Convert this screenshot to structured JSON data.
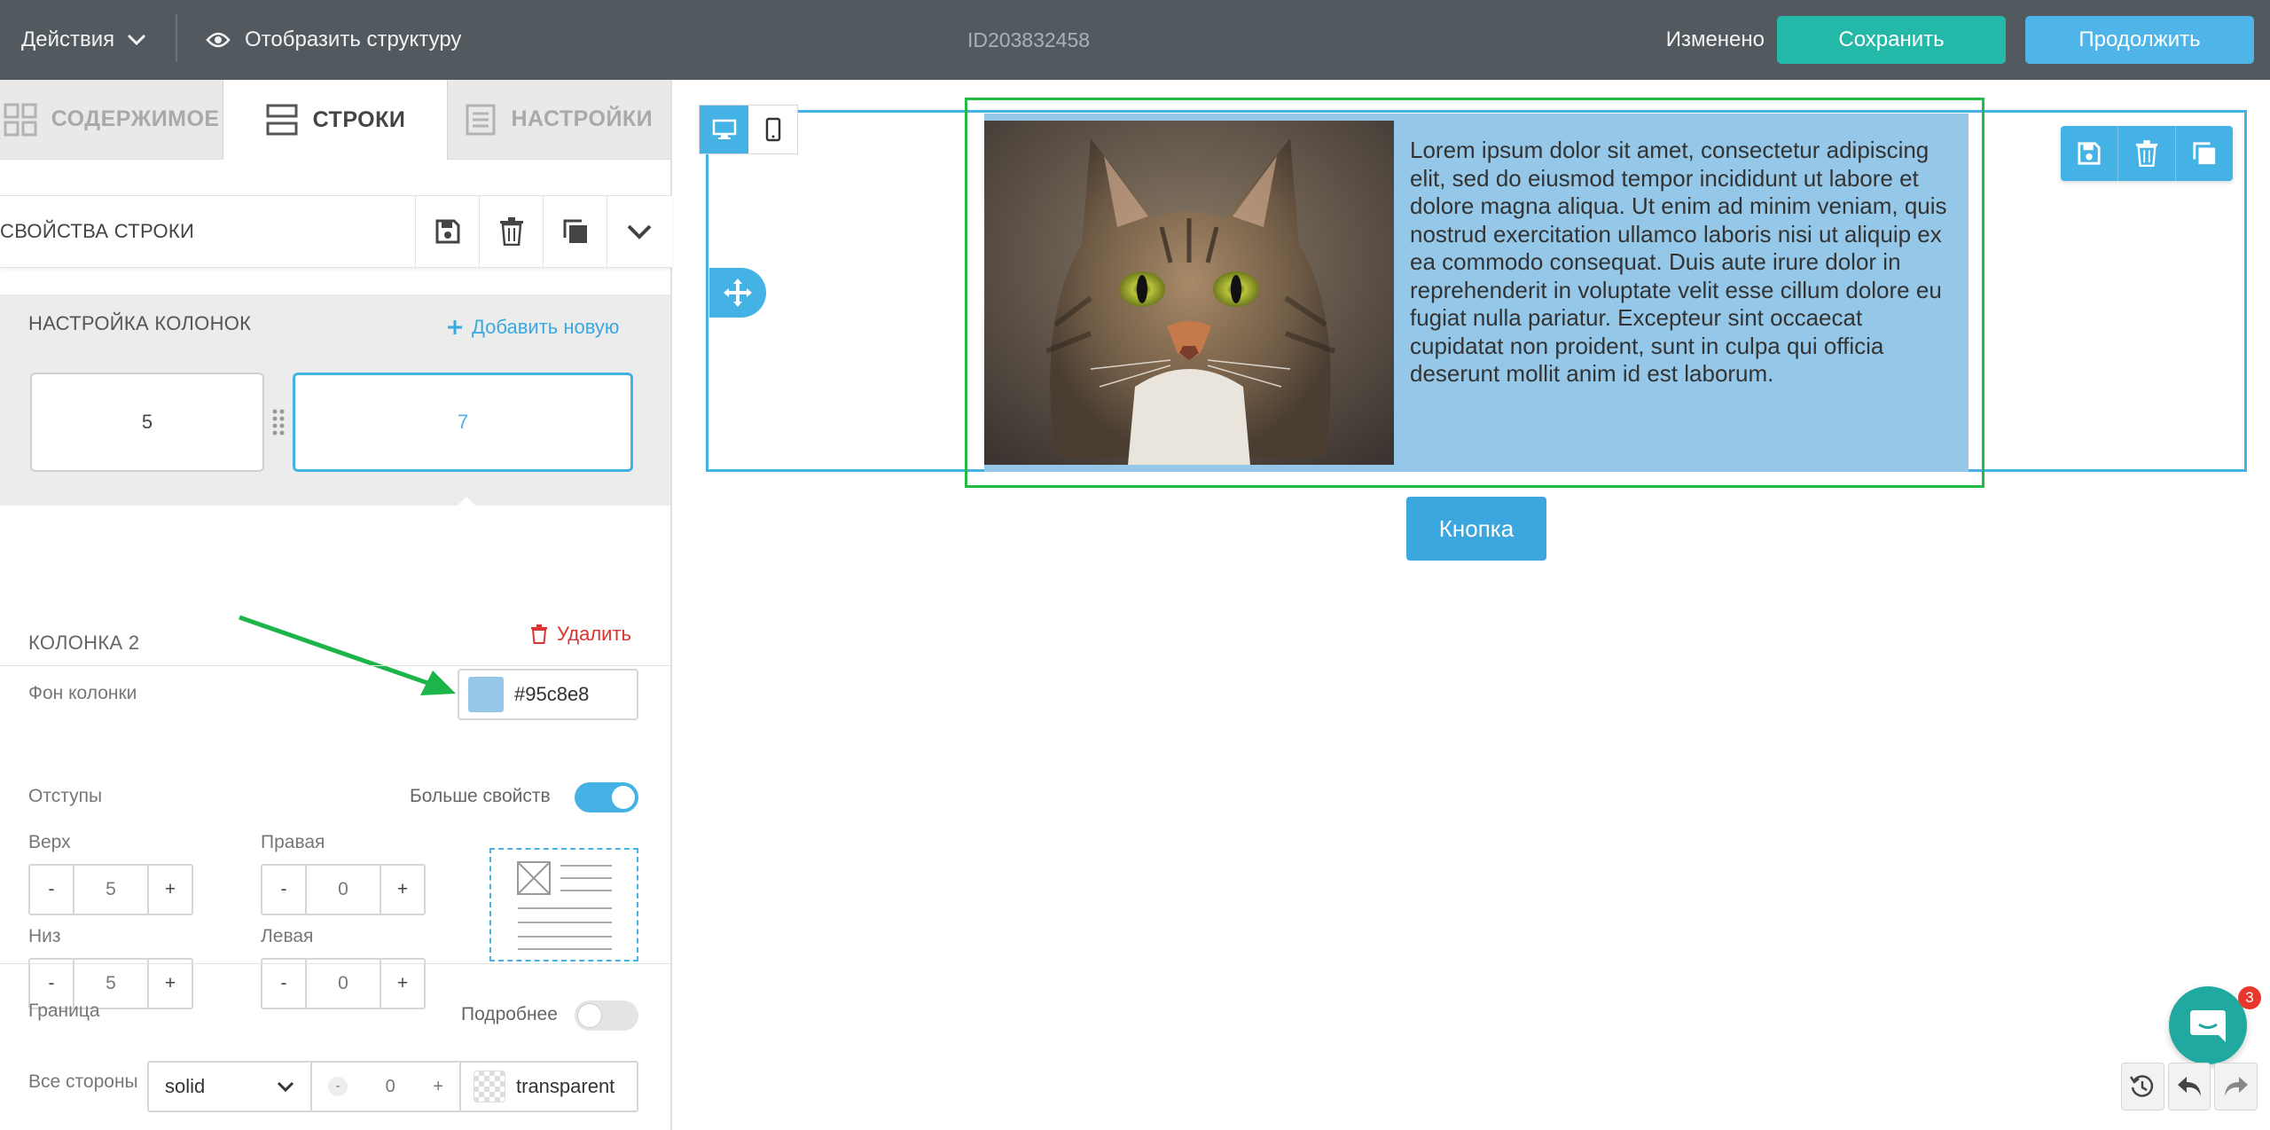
{
  "topbar": {
    "actions_label": "Действия",
    "structure_label": "Отобразить структуру",
    "document_id": "ID203832458",
    "status": "Изменено",
    "save_label": "Сохранить",
    "continue_label": "Продолжить"
  },
  "tabs": [
    {
      "label": "СОДЕРЖИМОЕ",
      "icon": "grid-icon"
    },
    {
      "label": "СТРОКИ",
      "icon": "rows-icon",
      "active": true
    },
    {
      "label": "НАСТРОЙКИ",
      "icon": "settings-doc-icon"
    }
  ],
  "row_props": {
    "title": "СВОЙСТВА СТРОКИ",
    "icons": [
      "save-icon",
      "trash-icon",
      "duplicate-icon",
      "chevron-down-icon"
    ]
  },
  "columns": {
    "title": "НАСТРОЙКА КОЛОНОК",
    "add_label": "Добавить новую",
    "widths": [
      "5",
      "7"
    ],
    "selected_index": 1
  },
  "column2": {
    "title": "КОЛОНКА 2",
    "delete_label": "Удалить",
    "bg_label": "Фон колонки",
    "bg_color": "#95c8e8",
    "bg_value": "#95c8e8"
  },
  "padding": {
    "title": "Отступы",
    "more_label": "Больше свойств",
    "more_enabled": true,
    "top_label": "Верх",
    "top_value": "5",
    "right_label": "Правая",
    "right_value": "0",
    "bottom_label": "Низ",
    "bottom_value": "5",
    "left_label": "Левая",
    "left_value": "0",
    "minus": "-",
    "plus": "+"
  },
  "border": {
    "title": "Граница",
    "details_label": "Подробнее",
    "details_enabled": false,
    "all_sides_label": "Все стороны",
    "style_value": "solid",
    "width_value": "0",
    "color_value": "transparent"
  },
  "canvas": {
    "lorem": "Lorem ipsum dolor sit amet, consectetur adipiscing elit, sed do eiusmod tempor incididunt ut labore et dolore magna aliqua. Ut enim ad minim veniam, quis nostrud exercitation ullamco laboris nisi ut aliquip ex ea commodo consequat. Duis aute irure dolor in reprehenderit in voluptate velit esse cillum dolore eu fugiat nulla pariatur. Excepteur sint occaecat cupidatat non proident, sunt in culpa qui officia deserunt mollit anim id est laborum.",
    "button_label": "Кнопка",
    "image_subject": "cat-photo"
  },
  "chat": {
    "badge_count": "3"
  },
  "colors": {
    "topbar": "#525a5f",
    "save": "#23b8a8",
    "accent": "#45b2e5",
    "column_bg": "#95c8e8",
    "frame_green": "#22bb44",
    "delete_red": "#dd3333"
  }
}
